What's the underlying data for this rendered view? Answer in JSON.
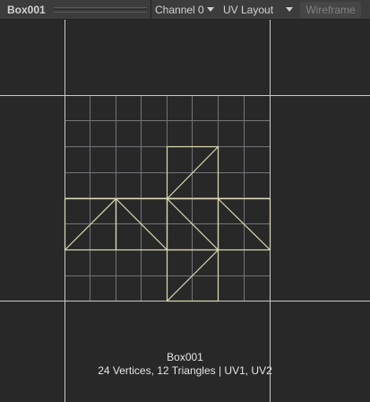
{
  "toolbar": {
    "object_name": "Box001",
    "channel": "Channel 0",
    "view_mode": "UV Layout",
    "wireframe": "Wireframe"
  },
  "info": {
    "name": "Box001",
    "stats": "24 Vertices, 12 Triangles | UV1, UV2"
  },
  "icons": {
    "dropdown": "caret-down-icon"
  },
  "colors": {
    "background": "#282828",
    "toolbar": "#3c3c3c",
    "grid": "#8c8c96",
    "axis": "#c8c8c8",
    "uv_wire": "#dedbb4"
  }
}
